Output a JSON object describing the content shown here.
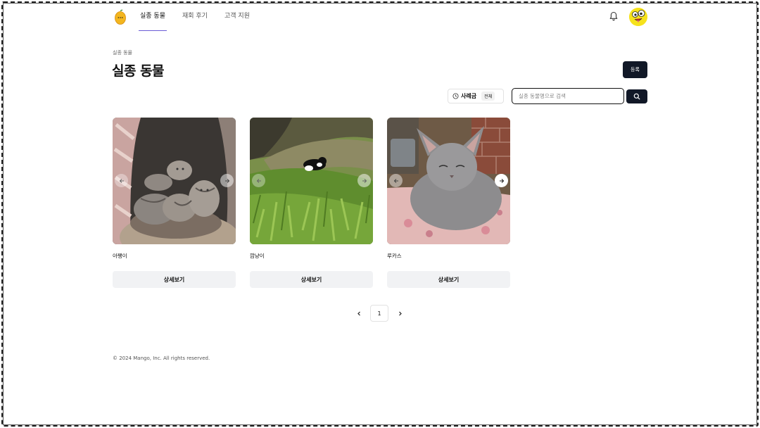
{
  "header": {
    "nav": [
      {
        "label": "실종 동물",
        "active": true
      },
      {
        "label": "재회 후기",
        "active": false
      },
      {
        "label": "고객 지원",
        "active": false
      }
    ]
  },
  "page": {
    "breadcrumb": "실종 동물",
    "title": "실종 동물",
    "register_label": "등록"
  },
  "filter": {
    "label": "사례금",
    "badge": "전체"
  },
  "search": {
    "placeholder": "실종 동물명으로 검색"
  },
  "cards": [
    {
      "name": "아쨍이",
      "button": "상세보기"
    },
    {
      "name": "깜냥이",
      "button": "상세보기"
    },
    {
      "name": "루카스",
      "button": "상세보기"
    }
  ],
  "pagination": {
    "current": "1"
  },
  "footer": {
    "copyright": "© 2024 Mango, Inc. All rights reserved."
  },
  "colors": {
    "primary": "#111827",
    "nav_underline": "#6a5cd6",
    "avatar_bg": "#f6e21c",
    "button_bg": "#f1f2f4"
  },
  "icons": [
    "mango-logo-icon",
    "bell-icon",
    "avatar",
    "clock-icon",
    "search-icon",
    "arrow-left-icon",
    "arrow-right-icon",
    "chevron-left-icon",
    "chevron-right-icon"
  ]
}
